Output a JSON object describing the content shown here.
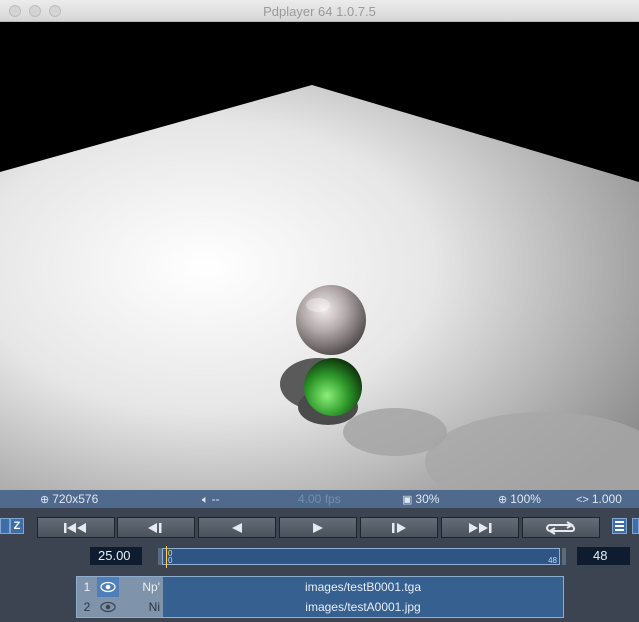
{
  "window": {
    "title": "Pdplayer 64 1.0.7.5"
  },
  "status": {
    "resolution": "720x576",
    "audio": "--",
    "fps": "4.00 fps",
    "cache": "30%",
    "zoom": "100%",
    "gamma": "1.000",
    "icons": [
      "resolution-icon",
      "speaker-icon",
      "cache-icon",
      "zoom-icon",
      "gamma-icon"
    ]
  },
  "side": {
    "left_label": "Z"
  },
  "transport": {
    "buttons": [
      "go-to-start",
      "step-back",
      "play-backward",
      "play-forward",
      "step-forward",
      "go-to-end",
      "loop"
    ]
  },
  "playback": {
    "frame_rate": "25.00",
    "end_frame": "48",
    "timeline_start_top": "0",
    "timeline_start_bottom": "0",
    "timeline_end": "48",
    "current_position": 0
  },
  "layers": [
    {
      "index": "1",
      "visible": true,
      "mode": "Np'",
      "file": "images/testB0001.tga"
    },
    {
      "index": "2",
      "visible": true,
      "mode": "Ni",
      "file": "images/testA0001.jpg"
    }
  ],
  "colors": {
    "statusbar": "#4f6a8c",
    "panel": "#3b4450",
    "timeline": "#2f5585",
    "accent": "#ffd24a"
  }
}
